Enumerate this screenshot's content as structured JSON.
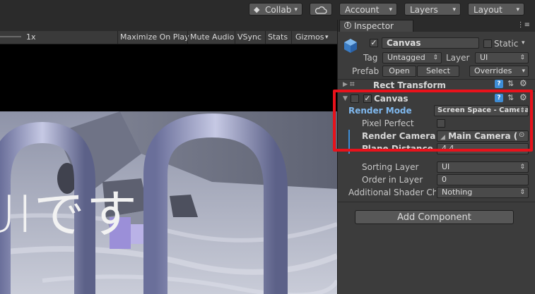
{
  "toolbar": {
    "collab_label": "Collab",
    "account_label": "Account",
    "layers_label": "Layers",
    "layout_label": "Layout"
  },
  "game_toolbar": {
    "scale": "1x",
    "maximize_on_play": "Maximize On Play",
    "mute_audio": "Mute Audio",
    "vsync": "VSync",
    "stats": "Stats",
    "gizmos": "Gizmos"
  },
  "game_view": {
    "overlay_text": "UIです"
  },
  "inspector": {
    "tab_label": "Inspector",
    "object_name": "Canvas",
    "static_label": "Static",
    "static_checked": false,
    "active_checked": true,
    "tag_label": "Tag",
    "tag_value": "Untagged",
    "layer_label": "Layer",
    "layer_value": "UI",
    "prefab_label": "Prefab",
    "prefab_open": "Open",
    "prefab_select": "Select",
    "prefab_overrides": "Overrides",
    "rect_transform_label": "Rect Transform",
    "canvas_component_label": "Canvas",
    "render_mode_label": "Render Mode",
    "render_mode_value": "Screen Space - Camera",
    "pixel_perfect_label": "Pixel Perfect",
    "pixel_perfect_checked": false,
    "render_camera_label": "Render Camera",
    "render_camera_value": "Main Camera (",
    "plane_distance_label": "Plane Distance",
    "plane_distance_value": "4.4",
    "sorting_layer_label": "Sorting Layer",
    "sorting_layer_value": "UI",
    "order_in_layer_label": "Order in Layer",
    "order_in_layer_value": "0",
    "additional_shader_label": "Additional Shader Ch",
    "additional_shader_value": "Nothing",
    "add_component_label": "Add Component"
  },
  "colors": {
    "highlight": "#e8121b",
    "accent_blue": "#3e8dd6"
  }
}
